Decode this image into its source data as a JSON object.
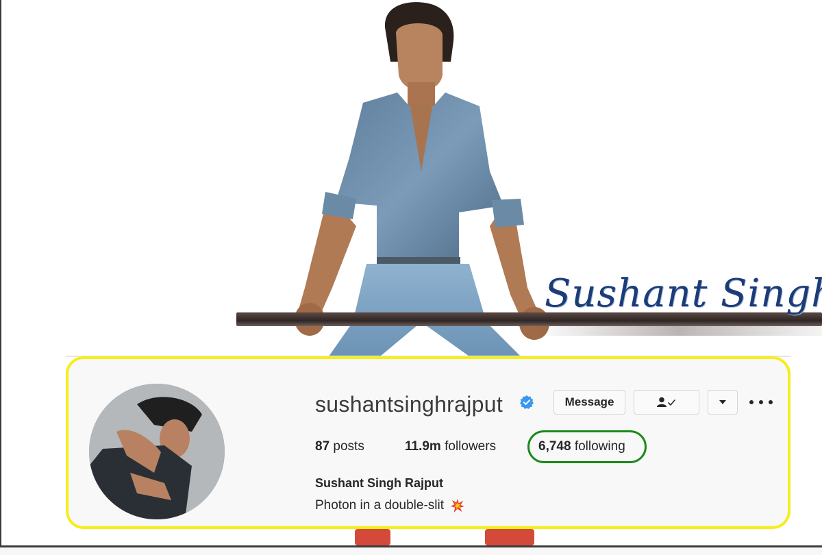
{
  "overlay": {
    "script_name": "Sushant Singh"
  },
  "profile": {
    "username": "sushantsinghrajput",
    "verified": true,
    "buttons": {
      "message_label": "Message",
      "follow_icon": "following-user-check-icon",
      "dropdown_icon": "caret-down-icon",
      "more_icon": "more-options-icon"
    },
    "stats": {
      "posts_count": "87",
      "posts_label": "posts",
      "followers_count": "11.9m",
      "followers_label": "followers",
      "following_count": "6,748",
      "following_label": "following"
    },
    "full_name": "Sushant Singh Rajput",
    "bio": "Photon in a double-slit",
    "bio_icon": "collision-emoji-icon"
  },
  "colors": {
    "card_border": "#f5ee1c",
    "highlight_ring": "#1b8a1b",
    "verified_badge": "#3897f0",
    "script_text": "#1c3c78"
  }
}
